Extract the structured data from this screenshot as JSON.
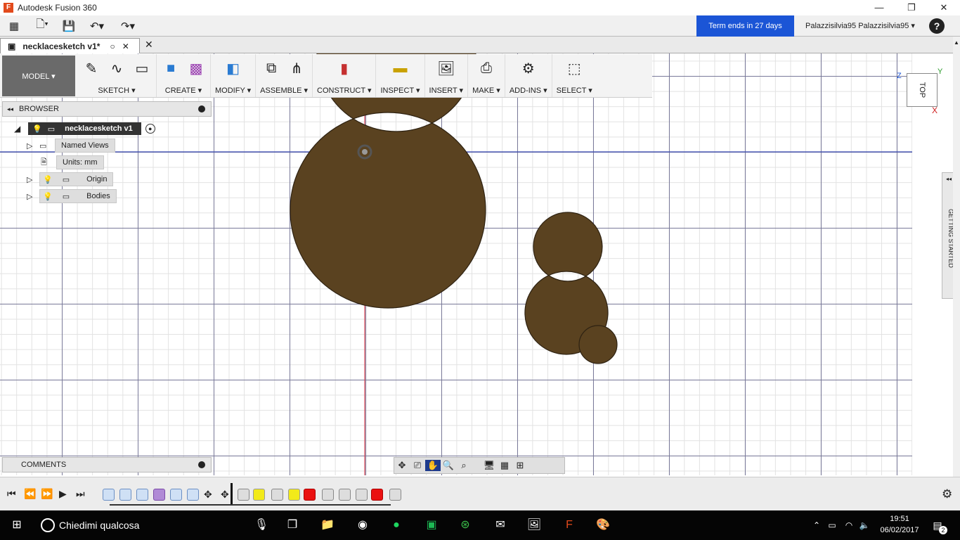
{
  "app": {
    "title": "Autodesk Fusion 360",
    "logo": "F"
  },
  "qat": {
    "term": "Term ends in 27 days",
    "user": "Palazzisilvia95 Palazzisilvia95 ▾",
    "help": "?"
  },
  "tab": {
    "name": "necklacesketch v1*"
  },
  "toolbar": {
    "model": "MODEL ▾",
    "groups": [
      {
        "label": "SKETCH ▾"
      },
      {
        "label": "CREATE ▾"
      },
      {
        "label": "MODIFY ▾"
      },
      {
        "label": "ASSEMBLE ▾"
      },
      {
        "label": "CONSTRUCT ▾"
      },
      {
        "label": "INSPECT ▾"
      },
      {
        "label": "INSERT ▾"
      },
      {
        "label": "MAKE ▾"
      },
      {
        "label": "ADD-INS ▾"
      },
      {
        "label": "SELECT ▾"
      }
    ]
  },
  "browser": {
    "title": "BROWSER",
    "root": "necklacesketch v1",
    "items": [
      "Named Views",
      "Units: mm",
      "Origin",
      "Bodies"
    ]
  },
  "comments": {
    "title": "COMMENTS"
  },
  "viewcube": {
    "face": "TOP",
    "z": "Z",
    "y": "Y",
    "x": "X"
  },
  "getting_started": "GETTING STARTED",
  "taskbar": {
    "search": "Chiedimi qualcosa",
    "time": "19:51",
    "date": "06/02/2017",
    "notif": "2"
  },
  "colors": {
    "body": "#5a4220",
    "accent": "#1b55d6"
  }
}
